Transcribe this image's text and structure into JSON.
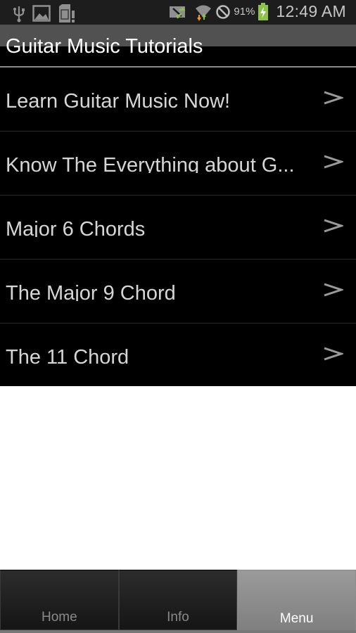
{
  "status_bar": {
    "left_icons": [
      "usb-icon",
      "image-icon",
      "sd-card-warning-icon"
    ],
    "right_icons": [
      "screen-mirroring-icon",
      "wifi-icon",
      "no-signal-icon",
      "battery-charging-icon"
    ],
    "battery_percent": "91%",
    "time": "12:49 AM",
    "battery_color": "#8bc34a"
  },
  "app": {
    "title": "Guitar Music Tutorials"
  },
  "list": {
    "items": [
      {
        "label": "Learn Guitar Music Now!",
        "icon": "chevron-right-icon"
      },
      {
        "label": "Know The Everything about G...",
        "icon": "chevron-right-icon"
      },
      {
        "label": "Major 6 Chords",
        "icon": "chevron-right-icon"
      },
      {
        "label": "The Major 9 Chord",
        "icon": "chevron-right-icon"
      },
      {
        "label": "The 11 Chord",
        "icon": "chevron-right-icon"
      }
    ]
  },
  "tabs": [
    {
      "label": "Home",
      "active": false
    },
    {
      "label": "Info",
      "active": false
    },
    {
      "label": "Menu",
      "active": true
    }
  ]
}
